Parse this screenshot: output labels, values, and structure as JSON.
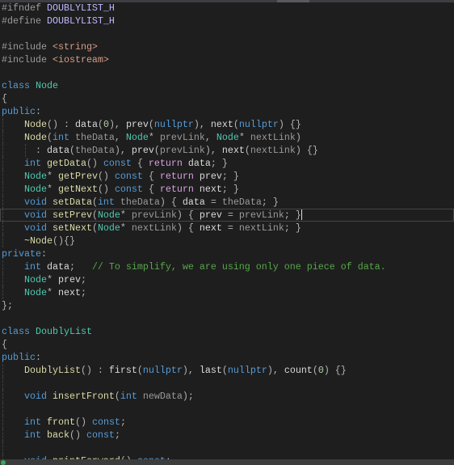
{
  "editor": {
    "language": "cpp",
    "current_line_index": 16,
    "lines": [
      {
        "indent": 0,
        "tokens": [
          [
            "pp",
            "#ifndef "
          ],
          [
            "macro",
            "DOUBLYLIST_H"
          ]
        ]
      },
      {
        "indent": 0,
        "tokens": [
          [
            "pp",
            "#define "
          ],
          [
            "macro",
            "DOUBLYLIST_H"
          ]
        ]
      },
      {
        "indent": 0,
        "tokens": []
      },
      {
        "indent": 0,
        "tokens": [
          [
            "pp",
            "#include "
          ],
          [
            "str",
            "<string>"
          ]
        ]
      },
      {
        "indent": 0,
        "tokens": [
          [
            "pp",
            "#include "
          ],
          [
            "str",
            "<iostream>"
          ]
        ]
      },
      {
        "indent": 0,
        "tokens": []
      },
      {
        "indent": 0,
        "tokens": [
          [
            "kw",
            "class "
          ],
          [
            "type",
            "Node"
          ]
        ]
      },
      {
        "indent": 0,
        "tokens": [
          [
            "punc",
            "{"
          ]
        ]
      },
      {
        "indent": 0,
        "tokens": [
          [
            "kw",
            "public"
          ],
          [
            "punc",
            ":"
          ]
        ]
      },
      {
        "indent": 1,
        "tokens": [
          [
            "fn",
            "Node"
          ],
          [
            "punc",
            "() : "
          ],
          [
            "member",
            "data"
          ],
          [
            "punc",
            "("
          ],
          [
            "num",
            "0"
          ],
          [
            "punc",
            "), "
          ],
          [
            "member",
            "prev"
          ],
          [
            "punc",
            "("
          ],
          [
            "kw",
            "nullptr"
          ],
          [
            "punc",
            "), "
          ],
          [
            "member",
            "next"
          ],
          [
            "punc",
            "("
          ],
          [
            "kw",
            "nullptr"
          ],
          [
            "punc",
            ") {}"
          ]
        ]
      },
      {
        "indent": 1,
        "tokens": [
          [
            "fn",
            "Node"
          ],
          [
            "punc",
            "("
          ],
          [
            "kw",
            "int "
          ],
          [
            "param",
            "theData"
          ],
          [
            "punc",
            ", "
          ],
          [
            "type",
            "Node"
          ],
          [
            "punc",
            "* "
          ],
          [
            "param",
            "prevLink"
          ],
          [
            "punc",
            ", "
          ],
          [
            "type",
            "Node"
          ],
          [
            "punc",
            "* "
          ],
          [
            "param",
            "nextLink"
          ],
          [
            "punc",
            ")"
          ]
        ]
      },
      {
        "indent": 2,
        "tokens": [
          [
            "punc",
            "  : "
          ],
          [
            "member",
            "data"
          ],
          [
            "punc",
            "("
          ],
          [
            "param",
            "theData"
          ],
          [
            "punc",
            "), "
          ],
          [
            "member",
            "prev"
          ],
          [
            "punc",
            "("
          ],
          [
            "param",
            "prevLink"
          ],
          [
            "punc",
            "), "
          ],
          [
            "member",
            "next"
          ],
          [
            "punc",
            "("
          ],
          [
            "param",
            "nextLink"
          ],
          [
            "punc",
            ") {}"
          ]
        ]
      },
      {
        "indent": 1,
        "tokens": [
          [
            "kw",
            "int "
          ],
          [
            "fn",
            "getData"
          ],
          [
            "punc",
            "() "
          ],
          [
            "kw",
            "const"
          ],
          [
            "punc",
            " { "
          ],
          [
            "ctl",
            "return "
          ],
          [
            "member",
            "data"
          ],
          [
            "punc",
            "; }"
          ]
        ]
      },
      {
        "indent": 1,
        "tokens": [
          [
            "type",
            "Node"
          ],
          [
            "punc",
            "* "
          ],
          [
            "fn",
            "getPrev"
          ],
          [
            "punc",
            "() "
          ],
          [
            "kw",
            "const"
          ],
          [
            "punc",
            " { "
          ],
          [
            "ctl",
            "return "
          ],
          [
            "member",
            "prev"
          ],
          [
            "punc",
            "; }"
          ]
        ]
      },
      {
        "indent": 1,
        "tokens": [
          [
            "type",
            "Node"
          ],
          [
            "punc",
            "* "
          ],
          [
            "fn",
            "getNext"
          ],
          [
            "punc",
            "() "
          ],
          [
            "kw",
            "const"
          ],
          [
            "punc",
            " { "
          ],
          [
            "ctl",
            "return "
          ],
          [
            "member",
            "next"
          ],
          [
            "punc",
            "; }"
          ]
        ]
      },
      {
        "indent": 1,
        "tokens": [
          [
            "kw",
            "void "
          ],
          [
            "fn",
            "setData"
          ],
          [
            "punc",
            "("
          ],
          [
            "kw",
            "int "
          ],
          [
            "param",
            "theData"
          ],
          [
            "punc",
            ") { "
          ],
          [
            "member",
            "data"
          ],
          [
            "punc",
            " = "
          ],
          [
            "param",
            "theData"
          ],
          [
            "punc",
            "; }"
          ]
        ]
      },
      {
        "indent": 1,
        "tokens": [
          [
            "kw",
            "void "
          ],
          [
            "fn",
            "setPrev"
          ],
          [
            "punc",
            "("
          ],
          [
            "type",
            "Node"
          ],
          [
            "punc",
            "* "
          ],
          [
            "param",
            "prevLink"
          ],
          [
            "punc",
            ") { "
          ],
          [
            "member",
            "prev"
          ],
          [
            "punc",
            " = "
          ],
          [
            "param",
            "prevLink"
          ],
          [
            "punc",
            "; }"
          ]
        ]
      },
      {
        "indent": 1,
        "tokens": [
          [
            "kw",
            "void "
          ],
          [
            "fn",
            "setNext"
          ],
          [
            "punc",
            "("
          ],
          [
            "type",
            "Node"
          ],
          [
            "punc",
            "* "
          ],
          [
            "param",
            "nextLink"
          ],
          [
            "punc",
            ") { "
          ],
          [
            "member",
            "next"
          ],
          [
            "punc",
            " = "
          ],
          [
            "param",
            "nextLink"
          ],
          [
            "punc",
            "; }"
          ]
        ]
      },
      {
        "indent": 1,
        "tokens": [
          [
            "fn",
            "~Node"
          ],
          [
            "punc",
            "(){}"
          ]
        ]
      },
      {
        "indent": 0,
        "tokens": [
          [
            "kw",
            "private"
          ],
          [
            "punc",
            ":"
          ]
        ]
      },
      {
        "indent": 1,
        "tokens": [
          [
            "kw",
            "int "
          ],
          [
            "member",
            "data"
          ],
          [
            "punc",
            ";   "
          ],
          [
            "cmt",
            "// To simplify, we are using only one piece of data."
          ]
        ]
      },
      {
        "indent": 1,
        "tokens": [
          [
            "type",
            "Node"
          ],
          [
            "punc",
            "* "
          ],
          [
            "member",
            "prev"
          ],
          [
            "punc",
            ";"
          ]
        ]
      },
      {
        "indent": 1,
        "tokens": [
          [
            "type",
            "Node"
          ],
          [
            "punc",
            "* "
          ],
          [
            "member",
            "next"
          ],
          [
            "punc",
            ";"
          ]
        ]
      },
      {
        "indent": 0,
        "tokens": [
          [
            "punc",
            "};"
          ]
        ]
      },
      {
        "indent": 0,
        "tokens": []
      },
      {
        "indent": 0,
        "tokens": [
          [
            "kw",
            "class "
          ],
          [
            "type",
            "DoublyList"
          ]
        ]
      },
      {
        "indent": 0,
        "tokens": [
          [
            "punc",
            "{"
          ]
        ]
      },
      {
        "indent": 0,
        "tokens": [
          [
            "kw",
            "public"
          ],
          [
            "punc",
            ":"
          ]
        ]
      },
      {
        "indent": 1,
        "tokens": [
          [
            "fn",
            "DoublyList"
          ],
          [
            "punc",
            "() : "
          ],
          [
            "member",
            "first"
          ],
          [
            "punc",
            "("
          ],
          [
            "kw",
            "nullptr"
          ],
          [
            "punc",
            "), "
          ],
          [
            "member",
            "last"
          ],
          [
            "punc",
            "("
          ],
          [
            "kw",
            "nullptr"
          ],
          [
            "punc",
            "), "
          ],
          [
            "member",
            "count"
          ],
          [
            "punc",
            "("
          ],
          [
            "num",
            "0"
          ],
          [
            "punc",
            ") {}"
          ]
        ]
      },
      {
        "indent": 1,
        "tokens": []
      },
      {
        "indent": 1,
        "tokens": [
          [
            "kw",
            "void "
          ],
          [
            "fn",
            "insertFront"
          ],
          [
            "punc",
            "("
          ],
          [
            "kw",
            "int "
          ],
          [
            "param",
            "newData"
          ],
          [
            "punc",
            ");"
          ]
        ]
      },
      {
        "indent": 1,
        "tokens": []
      },
      {
        "indent": 1,
        "tokens": [
          [
            "kw",
            "int "
          ],
          [
            "fn",
            "front"
          ],
          [
            "punc",
            "() "
          ],
          [
            "kw",
            "const"
          ],
          [
            "punc",
            ";"
          ]
        ]
      },
      {
        "indent": 1,
        "tokens": [
          [
            "kw",
            "int "
          ],
          [
            "fn",
            "back"
          ],
          [
            "punc",
            "() "
          ],
          [
            "kw",
            "const"
          ],
          [
            "punc",
            ";"
          ]
        ]
      },
      {
        "indent": 1,
        "tokens": []
      },
      {
        "indent": 1,
        "tokens": [
          [
            "kw",
            "void "
          ],
          [
            "fn",
            "printForward"
          ],
          [
            "punc",
            "() "
          ],
          [
            "kw",
            "const"
          ],
          [
            "punc",
            ";"
          ]
        ]
      }
    ]
  },
  "status_bar": {
    "icon": "status-ok-icon"
  }
}
